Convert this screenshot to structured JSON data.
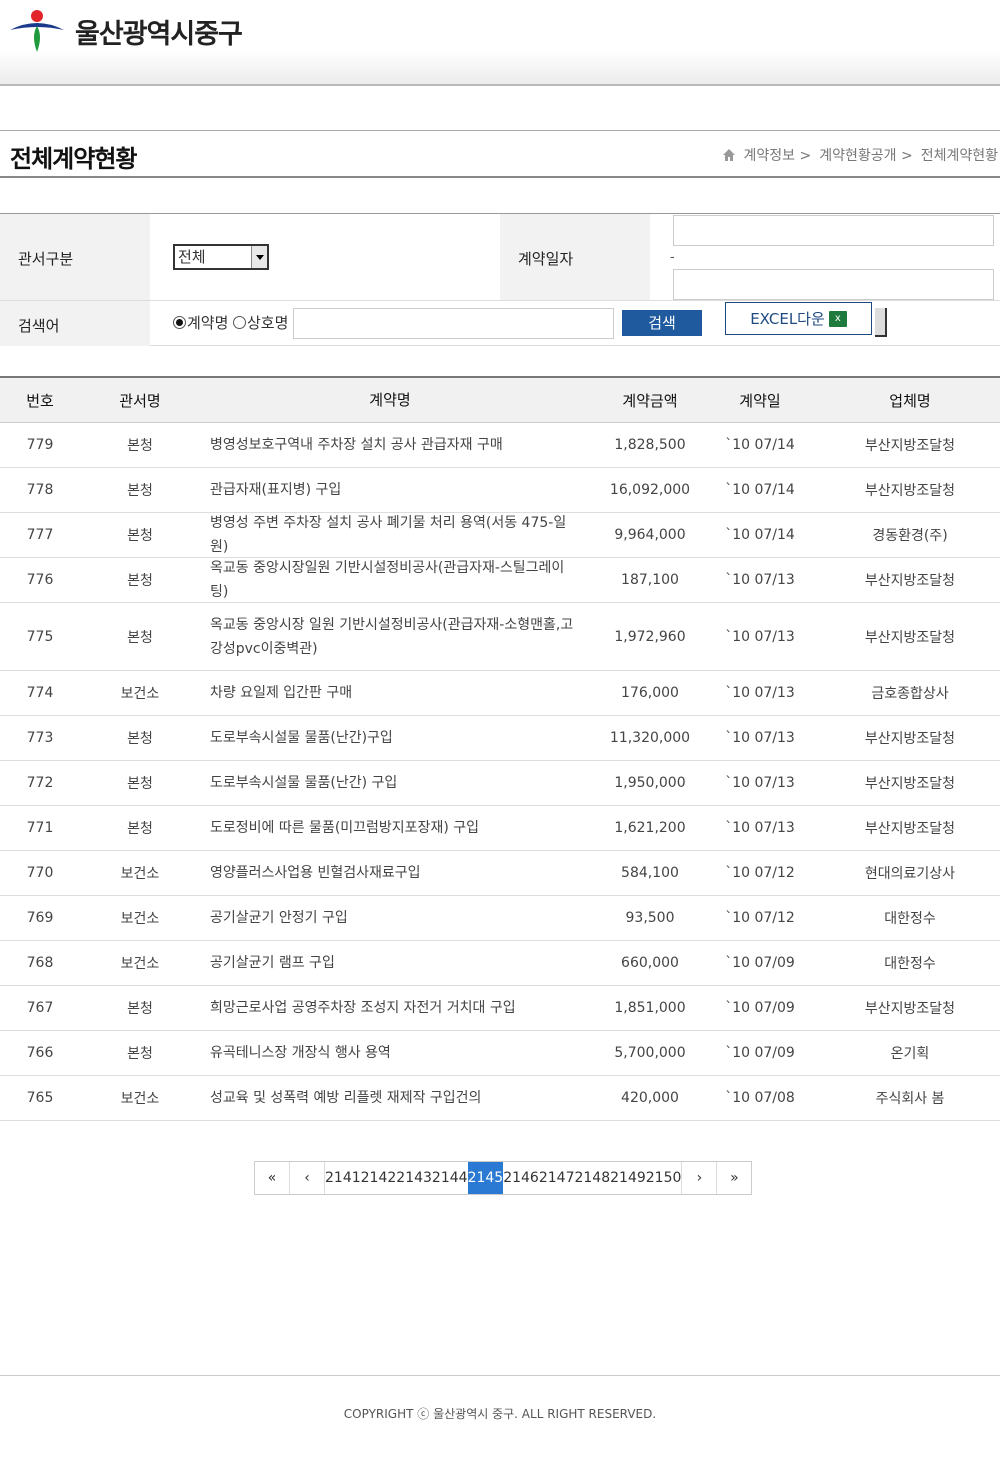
{
  "header": {
    "site_name": "울산광역시중구"
  },
  "page": {
    "title": "전체계약현황"
  },
  "breadcrumb": [
    "계약정보 >",
    "계약현황공개 >",
    "전체계약현황"
  ],
  "search": {
    "dept_label": "관서구분",
    "dept_value": "전체",
    "date_label": "계약일자",
    "date_sep": "-",
    "keyword_label": "검색어",
    "radio_contract": "계약명",
    "radio_company": "상호명",
    "search_button": "검색",
    "excel_button": "EXCEL다운",
    "excel_icon_text": "x"
  },
  "table": {
    "headers": [
      "번호",
      "관서명",
      "계약명",
      "계약금액",
      "계약일",
      "업체명"
    ],
    "rows": [
      [
        "779",
        "본청",
        "병영성보호구역내 주차장 설치 공사 관급자재 구매",
        "1,828,500",
        "`10 07/14",
        "부산지방조달청"
      ],
      [
        "778",
        "본청",
        "관급자재(표지병) 구입",
        "16,092,000",
        "`10 07/14",
        "부산지방조달청"
      ],
      [
        "777",
        "본청",
        "병영성 주변 주차장 설치 공사 폐기물 처리 용역(서동 475-일원)",
        "9,964,000",
        "`10 07/14",
        "경동환경(주)"
      ],
      [
        "776",
        "본청",
        "옥교동 중앙시장일원 기반시설정비공사(관급자재-스틸그레이팅)",
        "187,100",
        "`10 07/13",
        "부산지방조달청"
      ],
      [
        "775",
        "본청",
        "옥교동 중앙시장 일원 기반시설정비공사(관급자재-소형맨홀,고강성pvc이중벽관)",
        "1,972,960",
        "`10 07/13",
        "부산지방조달청"
      ],
      [
        "774",
        "보건소",
        "차량 요일제 입간판 구매",
        "176,000",
        "`10 07/13",
        "금호종합상사"
      ],
      [
        "773",
        "본청",
        "도로부속시설물 물품(난간)구입",
        "11,320,000",
        "`10 07/13",
        "부산지방조달청"
      ],
      [
        "772",
        "본청",
        "도로부속시설물 물품(난간) 구입",
        "1,950,000",
        "`10 07/13",
        "부산지방조달청"
      ],
      [
        "771",
        "본청",
        "도로정비에 따른 물품(미끄럼방지포장재) 구입",
        "1,621,200",
        "`10 07/13",
        "부산지방조달청"
      ],
      [
        "770",
        "보건소",
        "영양플러스사업용 빈혈검사재료구입",
        "584,100",
        "`10 07/12",
        "현대의료기상사"
      ],
      [
        "769",
        "보건소",
        "공기살균기 안정기 구입",
        "93,500",
        "`10 07/12",
        "대한정수"
      ],
      [
        "768",
        "보건소",
        "공기살균기 램프 구입",
        "660,000",
        "`10 07/09",
        "대한정수"
      ],
      [
        "767",
        "본청",
        "희망근로사업 공영주차장 조성지 자전거 거치대 구입",
        "1,851,000",
        "`10 07/09",
        "부산지방조달청"
      ],
      [
        "766",
        "본청",
        "유곡테니스장 개장식 행사 용역",
        "5,700,000",
        "`10 07/09",
        "온기획"
      ],
      [
        "765",
        "보건소",
        "성교육 및 성폭력 예방 리플렛 재제작 구입건의",
        "420,000",
        "`10 07/08",
        "주식회사 봄"
      ]
    ]
  },
  "pagination": {
    "first": "«",
    "prev": "‹",
    "next": "›",
    "last": "»",
    "pages": [
      "2141",
      "2142",
      "2143",
      "2144",
      "2145",
      "2146",
      "2147",
      "2148",
      "2149",
      "2150"
    ],
    "current": "2145"
  },
  "footer": {
    "copyright": "COPYRIGHT ⓒ 울산광역시 중구. ALL RIGHT RESERVED."
  }
}
